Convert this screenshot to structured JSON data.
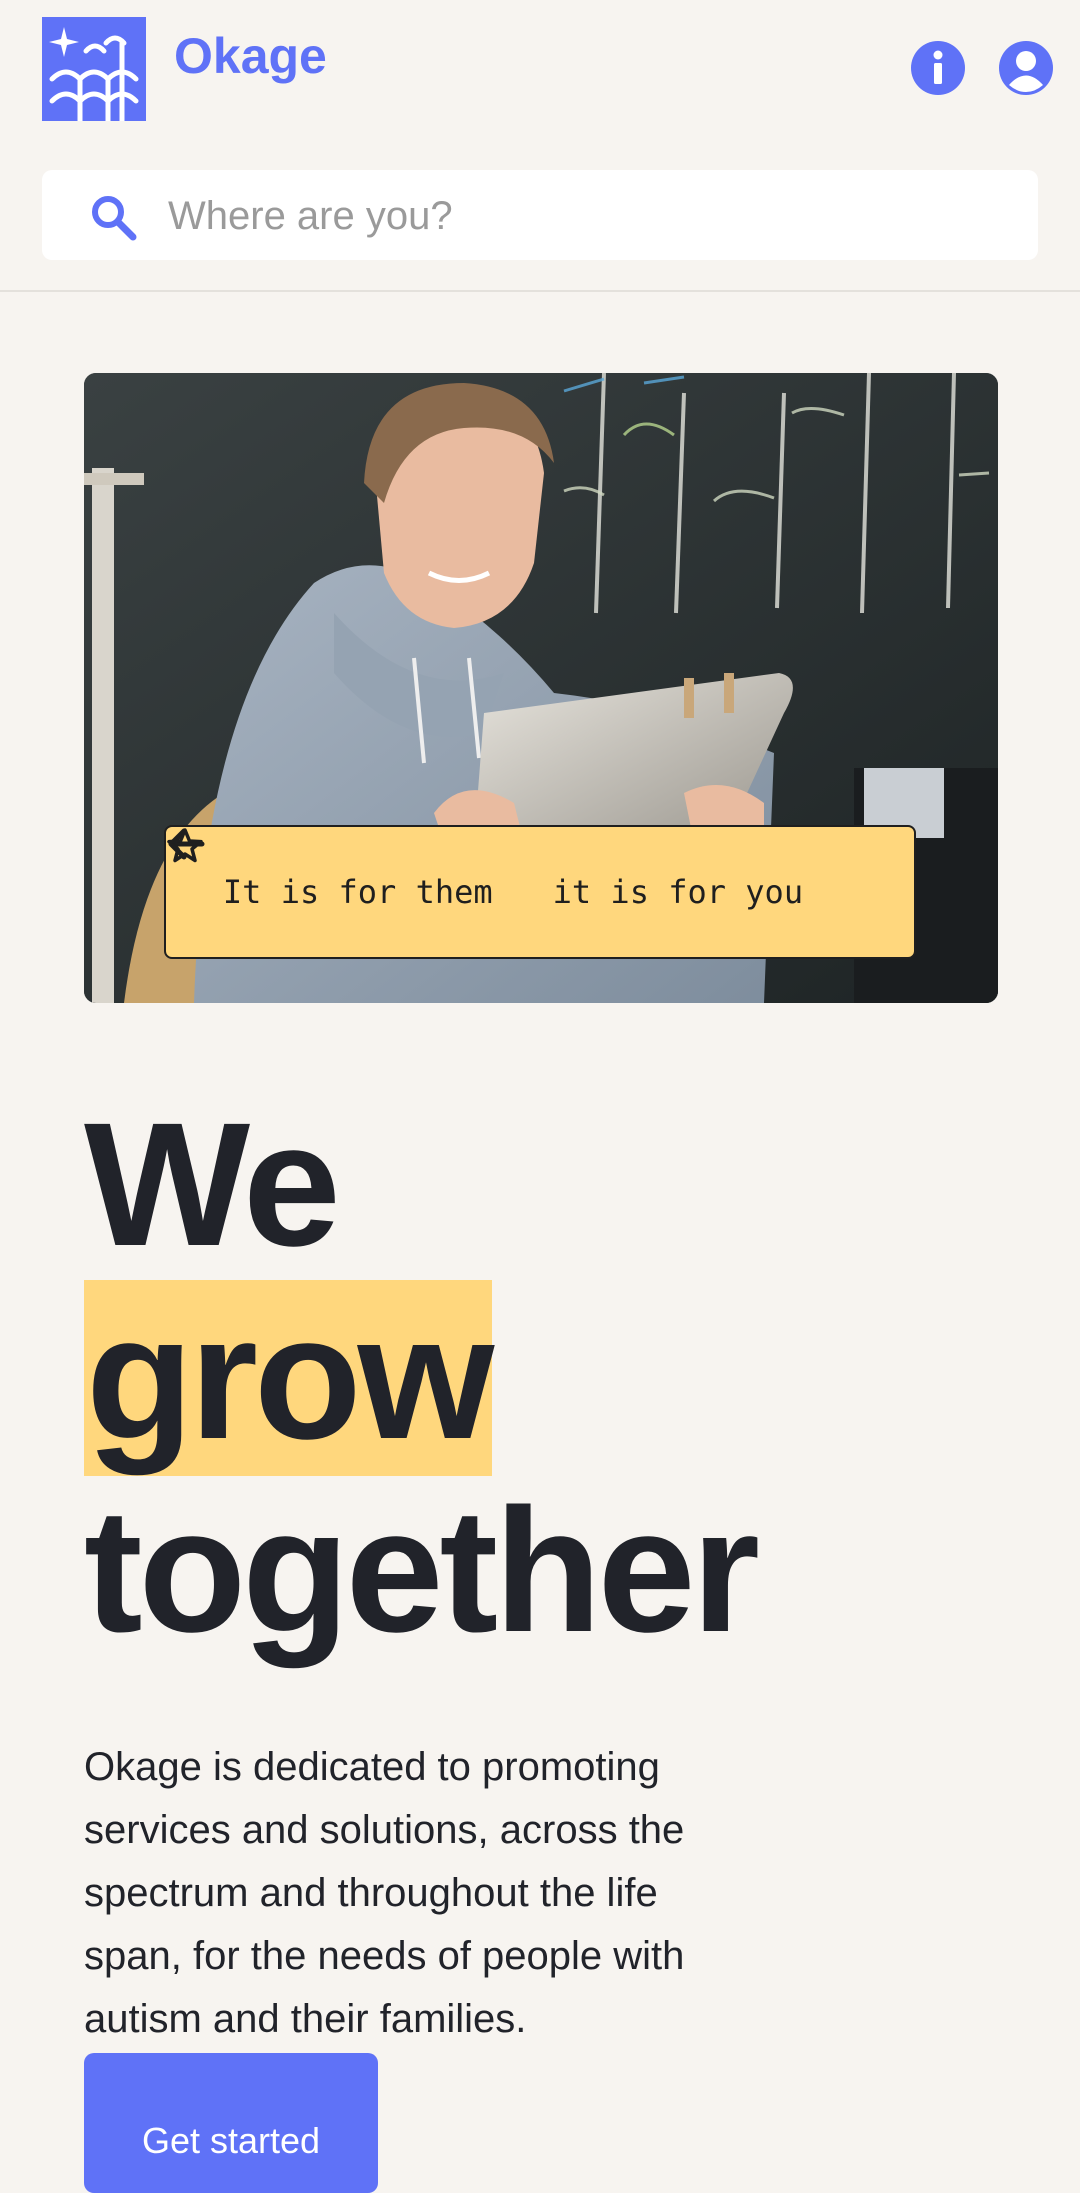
{
  "header": {
    "brand": "Okage",
    "search_placeholder": "Where are you?",
    "icons": [
      "logo-icon",
      "info-icon",
      "user-icon",
      "search-icon"
    ]
  },
  "hero": {
    "image": "student-with-tablet",
    "tagline_part1": "It is for them",
    "tagline_part2": "it is for you",
    "icons": [
      "arrow-left-icon",
      "star-icon"
    ]
  },
  "headline": {
    "line1": "We",
    "line2": "grow",
    "line3": "together"
  },
  "description": "Okage is dedicated to promoting services and solutions, across the spectrum and throughout the life span, for the needs of people with autism and their families.",
  "cta": {
    "label": "Get started"
  },
  "colors": {
    "accent": "#5f72f7",
    "highlight": "#ffd77d",
    "background": "#f7f4f0",
    "text": "#21232a"
  }
}
